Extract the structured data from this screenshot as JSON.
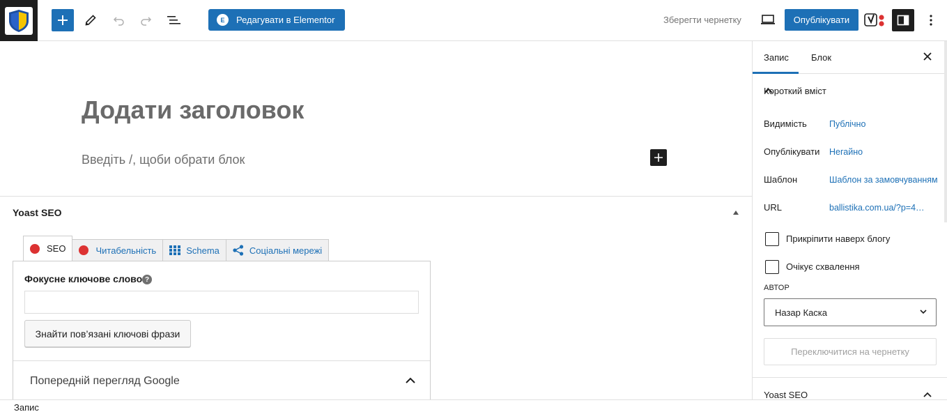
{
  "toolbar": {
    "elementor_label": "Редагувати в Elementor",
    "save_draft_label": "Зберегти чернетку",
    "publish_label": "Опублікувати"
  },
  "editor": {
    "title_placeholder": "Додати заголовок",
    "block_placeholder": "Введіть /, щоби обрати блок"
  },
  "yoast": {
    "metabox_title": "Yoast SEO",
    "tabs": [
      {
        "label": "SEO"
      },
      {
        "label": "Читабельність"
      },
      {
        "label": "Schema"
      },
      {
        "label": "Соціальні мережі"
      }
    ],
    "focus_keyword_label": "Фокусне ключове слово",
    "focus_keyword_value": "",
    "related_button_label": "Знайти пов’язані ключові фрази",
    "google_preview_label": "Попередній перегляд Google",
    "status_color": "#dc3232"
  },
  "footer": {
    "breadcrumb": "Запис"
  },
  "sidebar": {
    "tabs": [
      {
        "label": "Запис"
      },
      {
        "label": "Блок"
      }
    ],
    "summary_title": "Короткий вміст",
    "rows": [
      {
        "label": "Видимість",
        "value": "Публічно"
      },
      {
        "label": "Опублікувати",
        "value": "Негайно"
      },
      {
        "label": "Шаблон",
        "value": "Шаблон за замовчуванням"
      },
      {
        "label": "URL",
        "value": "ballistika.com.ua/?p=4…"
      }
    ],
    "checkboxes": [
      {
        "label": "Прикріпити наверх блогу",
        "checked": false
      },
      {
        "label": "Очікує схвалення",
        "checked": false
      }
    ],
    "author_label": "АВТОР",
    "author_value": "Назар Каска",
    "switch_draft_label": "Переключитися на чернетку",
    "yoast_panel_title": "Yoast SEO"
  },
  "colors": {
    "accent": "#1d70b6",
    "dark": "#1e1e1e",
    "muted": "#757575"
  }
}
